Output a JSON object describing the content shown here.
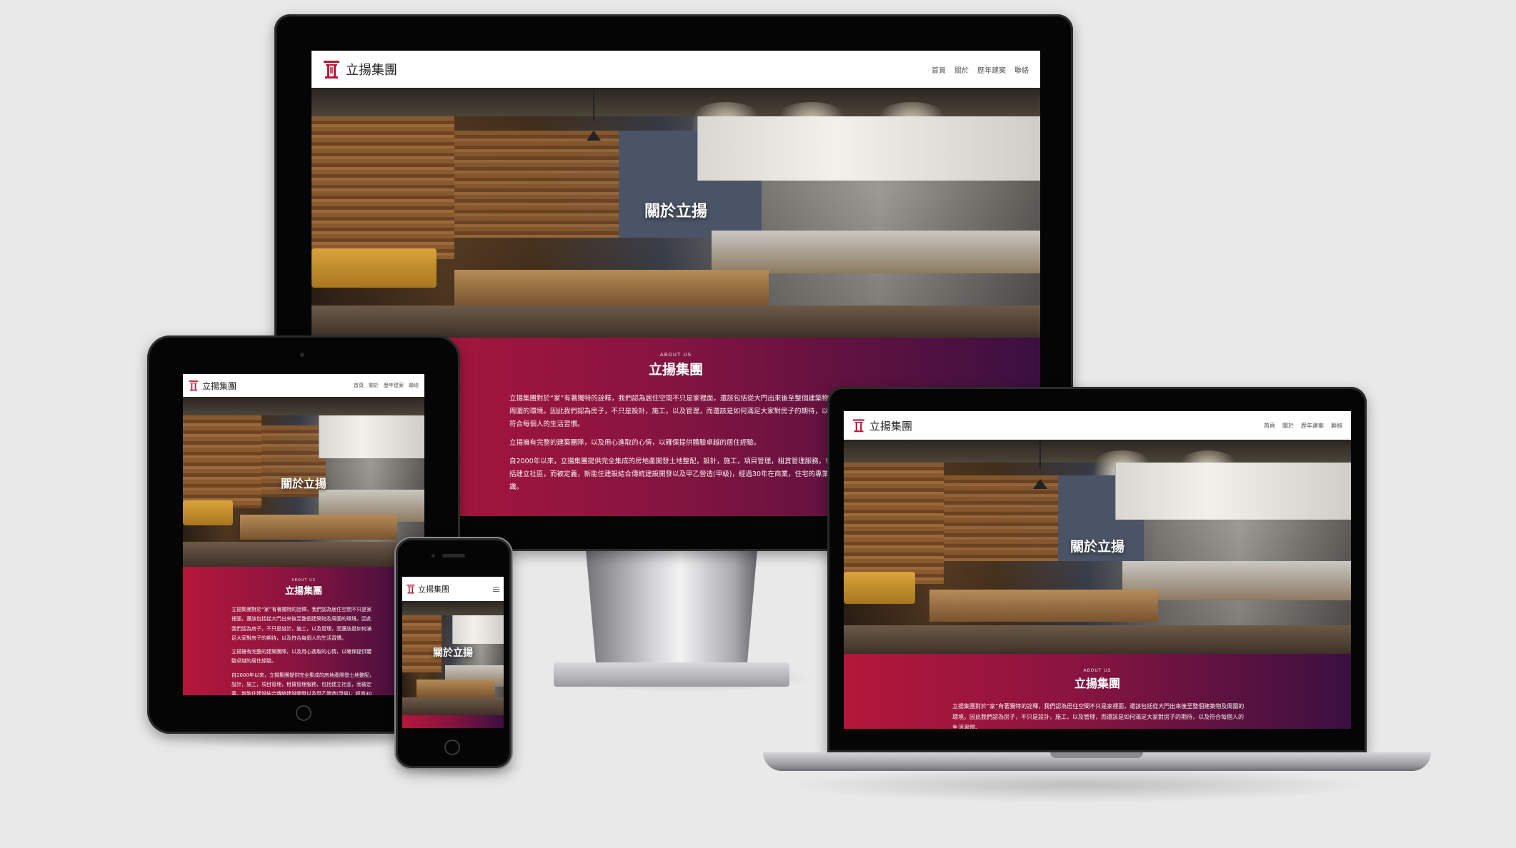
{
  "site": {
    "brand": "立揚集團",
    "nav": [
      "首頁",
      "關於",
      "歷年建案",
      "聯絡"
    ],
    "hero_title": "關於立揚",
    "about_kicker": "ABOUT US",
    "about_heading": "立揚集團",
    "about_paragraphs": [
      "立揚集團對於“家”有著獨特的詮釋，我們認為居住空間不只是家裡面，還該包括從大門出來後至整個建築物及周圍的環境。因此我們認為房子，不只是設計，施工，以及管理，而還該是如何滿足大家對房子的期待，以及符合每個人的生活習慣。",
      "立揚擁有完整的建築團隊，以及用心進取的心情，以確保提供體驗卓越的居住經驗。",
      "自2000年以來，立揚集團提供完全集成的房地產開發土地整配，設計，施工，項目管理，租賃管理服務，包括建立社區，而被定義，新能住建設結合傳統建設開發以及甲乙營造(甲級)，經過30年在商業，住宅的專業知識。"
    ]
  },
  "colors": {
    "accent_start": "#b5173a",
    "accent_end": "#3a1040",
    "logo": "#b5173a"
  },
  "icons": {
    "logo": "temple-gate-logo",
    "mobile_menu": "hamburger-menu-icon"
  }
}
